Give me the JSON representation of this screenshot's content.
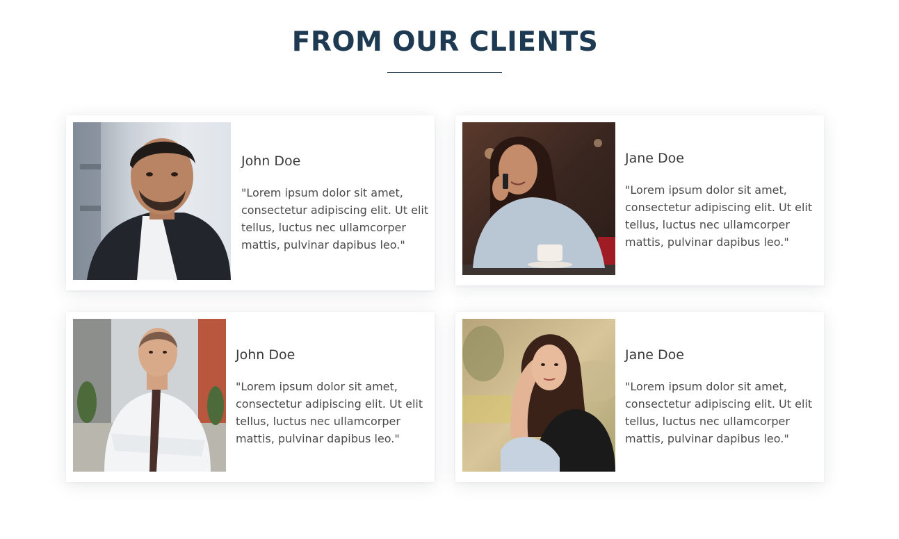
{
  "section": {
    "title": "FROM OUR CLIENTS"
  },
  "testimonials": [
    {
      "name": "John Doe",
      "quote": "\"Lorem ipsum dolor sit amet, consectetur adipiscing elit. Ut elit tellus, luctus nec ullamcorper mattis, pulvinar dapibus leo.\"",
      "photo": "man-in-black-blazer-photo"
    },
    {
      "name": "Jane Doe",
      "quote": "\"Lorem ipsum dolor sit amet, consectetur adipiscing elit. Ut elit tellus, luctus nec ullamcorper mattis, pulvinar dapibus leo.\"",
      "photo": "woman-on-phone-in-cafe-photo"
    },
    {
      "name": "John Doe",
      "quote": "\"Lorem ipsum dolor sit amet, consectetur adipiscing elit. Ut elit tellus, luctus nec ullamcorper mattis, pulvinar dapibus leo.\"",
      "photo": "man-in-white-shirt-arms-crossed-photo"
    },
    {
      "name": "Jane Doe",
      "quote": "\"Lorem ipsum dolor sit amet, consectetur adipiscing elit. Ut elit tellus, luctus nec ullamcorper mattis, pulvinar dapibus leo.\"",
      "photo": "woman-outdoors-sunset-photo"
    }
  ],
  "colors": {
    "title": "#1e3a52",
    "name_text": "#3a3a3a",
    "quote_text": "#4a4a4a",
    "card_background": "#ffffff"
  }
}
